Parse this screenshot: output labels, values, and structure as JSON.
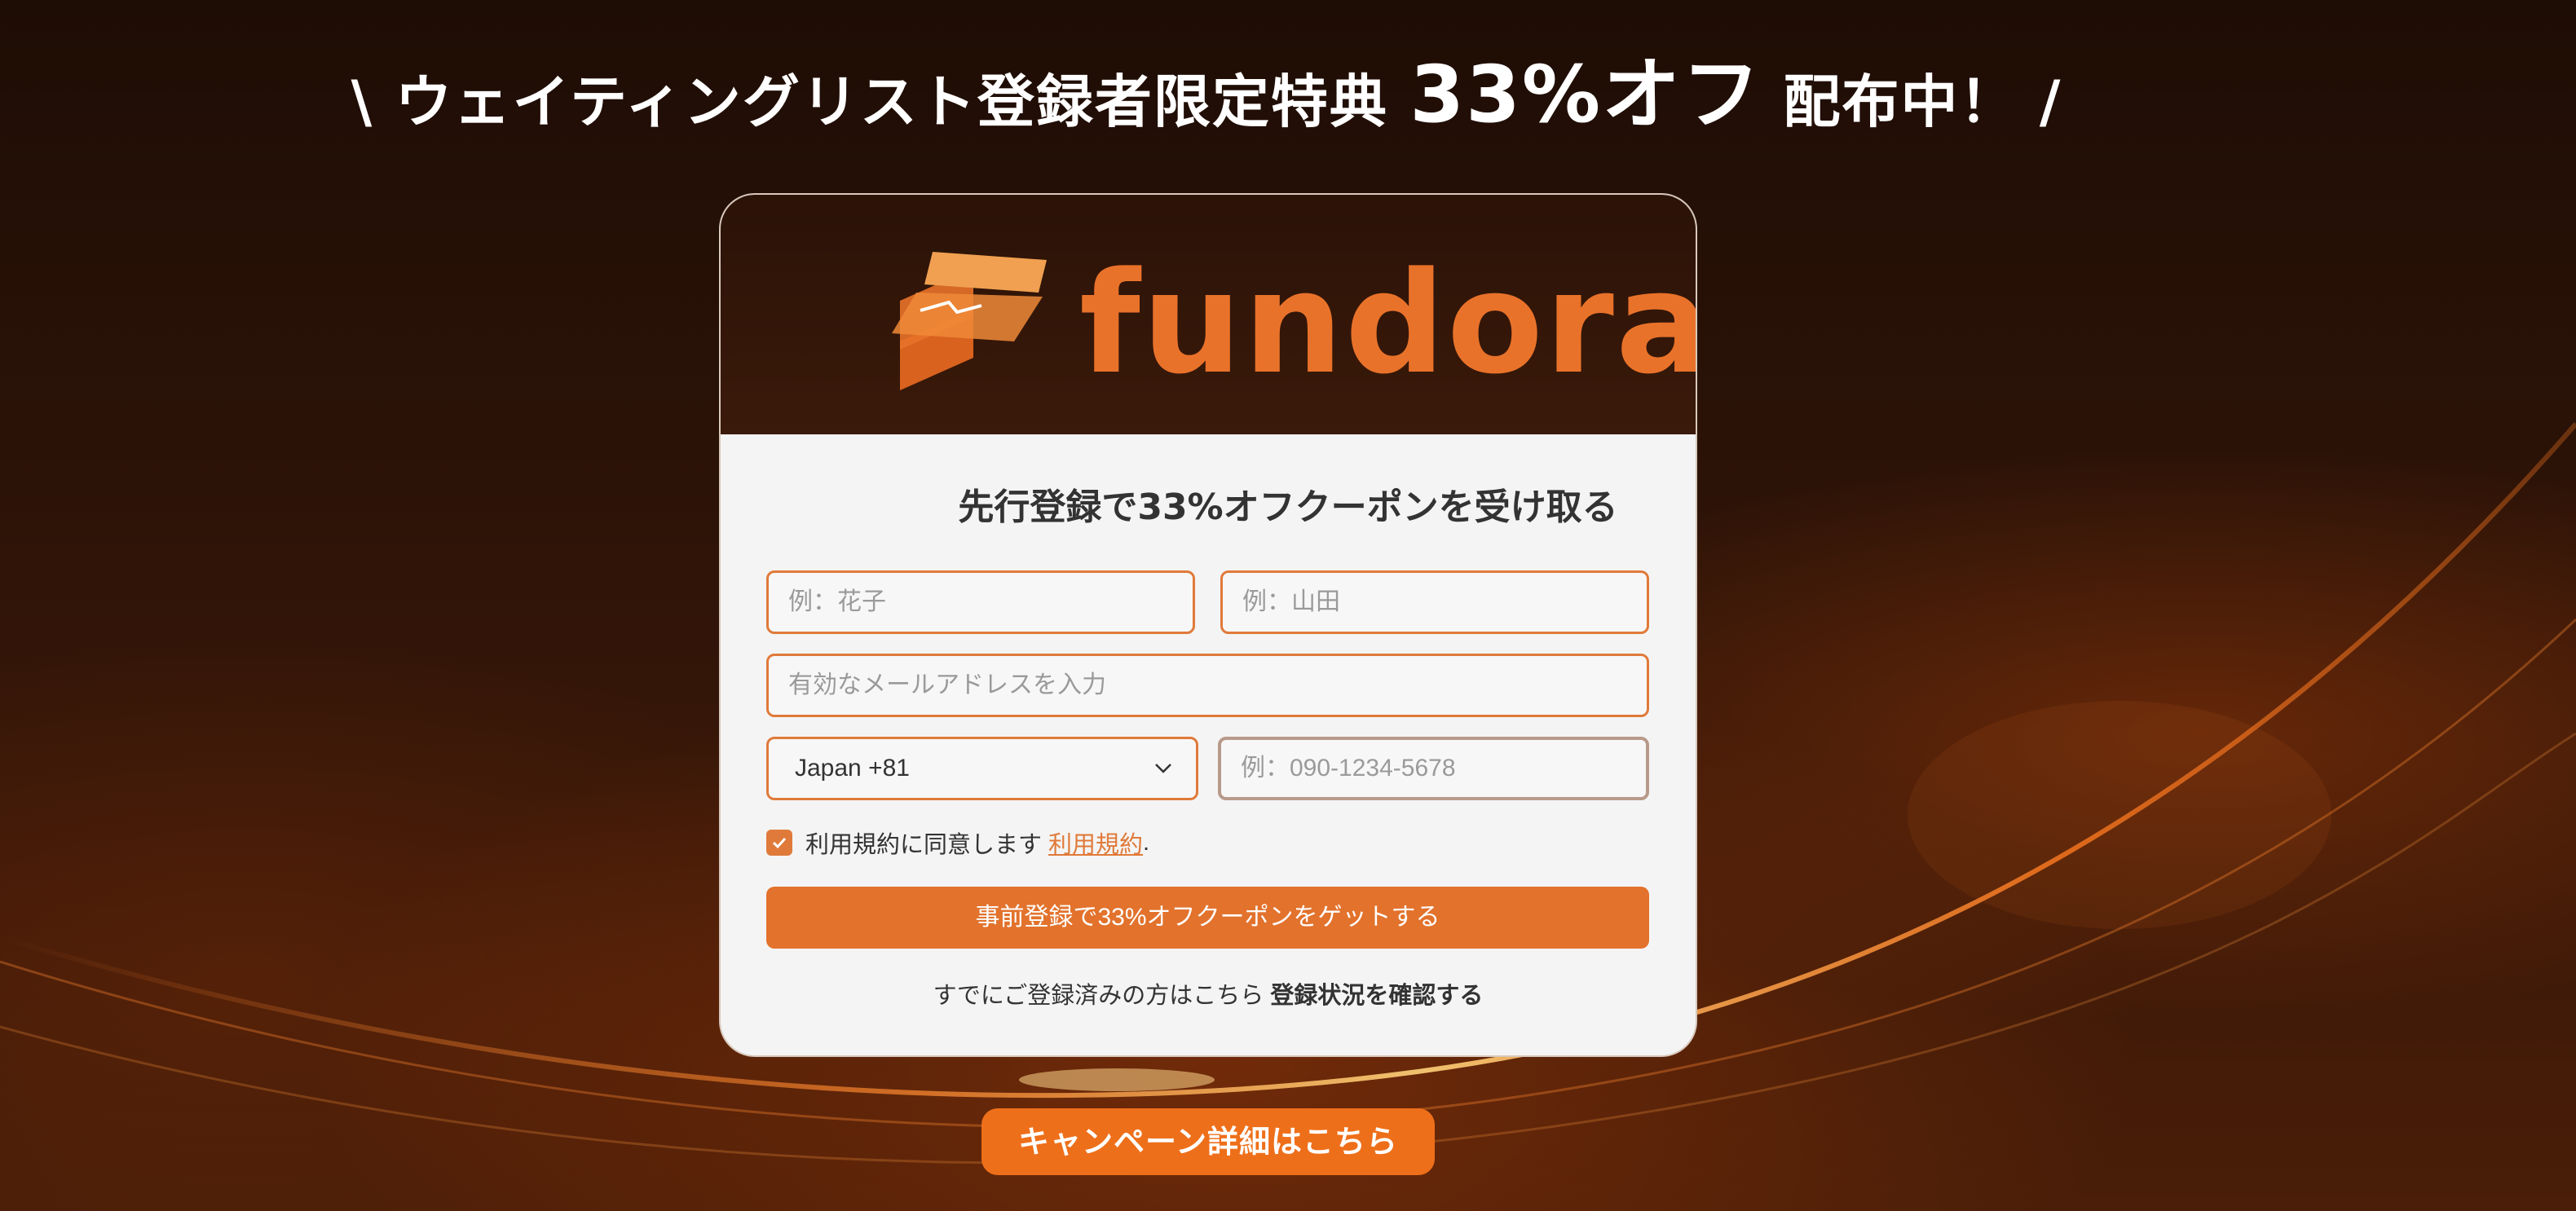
{
  "headline": {
    "prefix": "\\ ウェイティングリスト登録者限定特典 ",
    "highlight": "33%オフ",
    "suffix": " 配布中！ /"
  },
  "brand": {
    "name": "fundora",
    "accent_color": "#e9722a"
  },
  "form": {
    "title": "先行登録で33%オフクーポンを受け取る",
    "first_name_placeholder": "例：花子",
    "last_name_placeholder": "例：山田",
    "email_placeholder": "有効なメールアドレスを入力",
    "country_value": "Japan +81",
    "phone_placeholder": "例：090-1234-5678",
    "agree_text": "利用規約に同意します",
    "terms_link": "利用規約",
    "terms_period": ".",
    "agree_checked": true,
    "submit_label": "事前登録で33%オフクーポンをゲットする",
    "already_text": "すでにご登録済みの方はこちら ",
    "already_link": "登録状況を確認する"
  },
  "campaign_button": "キャンペーン詳細はこちら",
  "icons": {
    "chevron": "chevron-down-icon",
    "check": "check-icon",
    "logo": "fundora-logo-icon"
  }
}
